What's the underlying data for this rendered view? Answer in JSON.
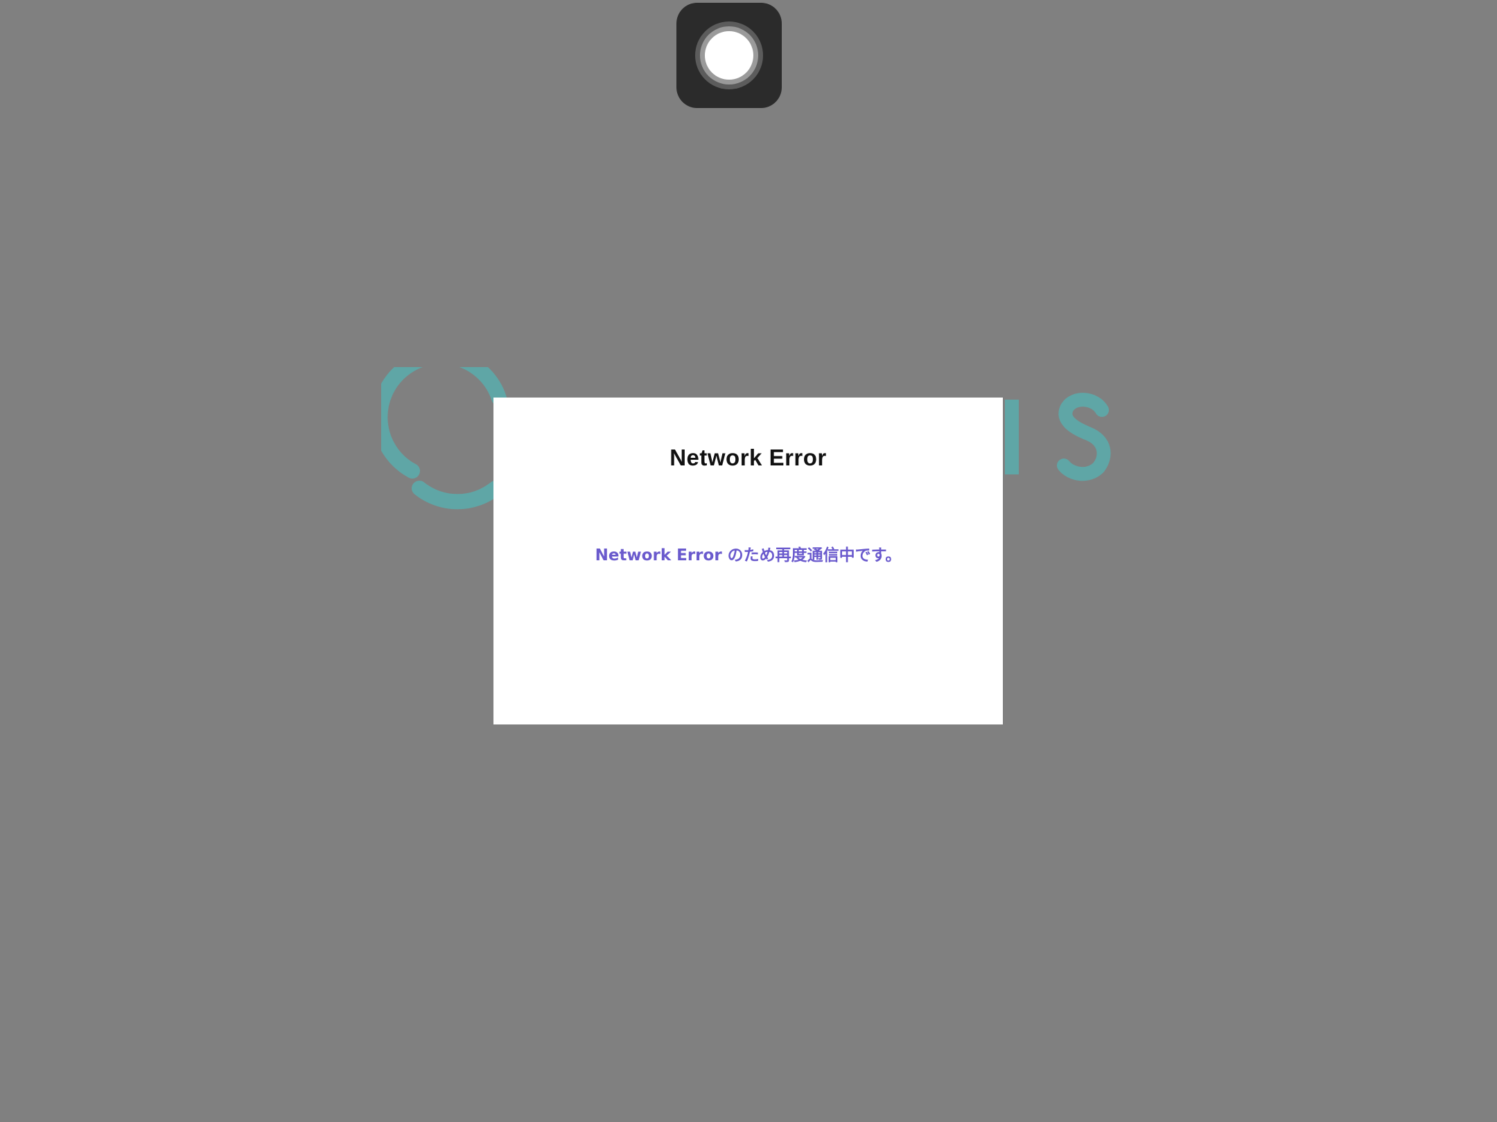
{
  "dialog": {
    "title": "Network Error",
    "message": "Network Error のため再度通信中です。"
  },
  "colors": {
    "backdrop": "#808080",
    "logo": "#5fa6a6",
    "message_text": "#6a5acd",
    "assistive_touch": "#2b2b2b"
  },
  "icons": {
    "assistive_touch": "assistive-touch-icon",
    "logo_ring": "logo-ring-icon"
  }
}
